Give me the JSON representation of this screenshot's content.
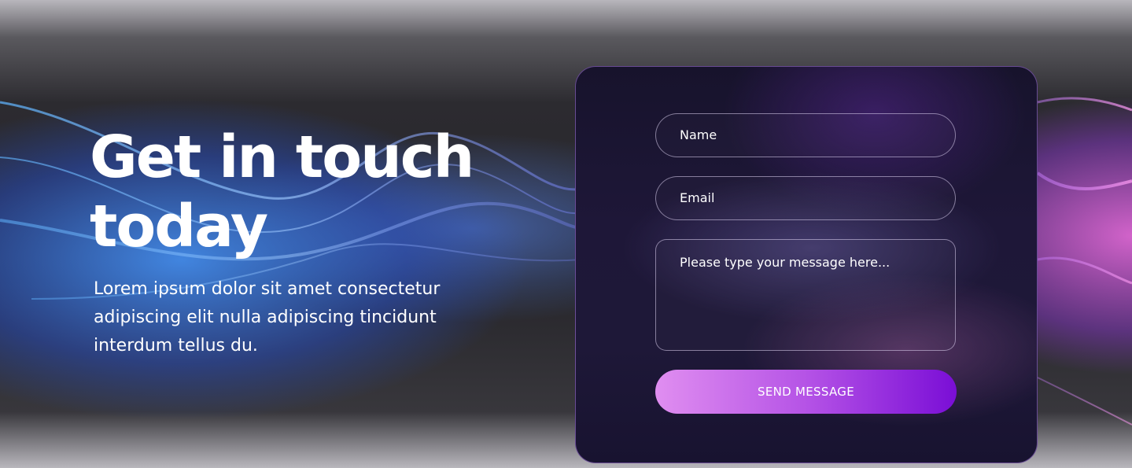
{
  "hero": {
    "title_line1": "Get in touch",
    "title_line2": "today",
    "text_line1": "Lorem ipsum dolor sit amet consectetur",
    "text_line2": "adipiscing elit nulla adipiscing tincidunt",
    "text_line3": "interdum tellus du."
  },
  "form": {
    "name_placeholder": "Name",
    "email_placeholder": "Email",
    "message_placeholder": "Please type your message here...",
    "submit_label": "SEND MESSAGE"
  }
}
